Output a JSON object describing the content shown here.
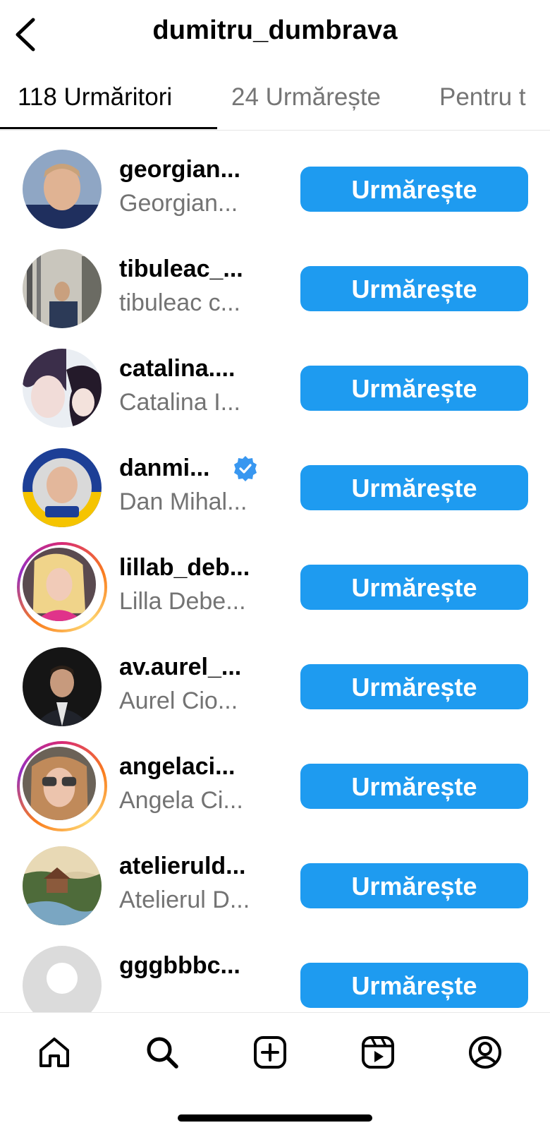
{
  "header": {
    "title": "dumitru_dumbrava"
  },
  "tabs": [
    {
      "label": "118 Urmăritori",
      "active": true
    },
    {
      "label": "24 Urmărește",
      "active": false
    },
    {
      "label": "Pentru t",
      "active": false
    }
  ],
  "follow_label": "Urmărește",
  "followers": [
    {
      "username": "georgian...",
      "full_name": "Georgian...",
      "verified": false,
      "story_ring": false
    },
    {
      "username": "tibuleac_...",
      "full_name": "tibuleac c...",
      "verified": false,
      "story_ring": false
    },
    {
      "username": "catalina....",
      "full_name": "Catalina I...",
      "verified": false,
      "story_ring": false
    },
    {
      "username": "danmi...",
      "full_name": "Dan Mihal...",
      "verified": true,
      "story_ring": false
    },
    {
      "username": "lillab_deb...",
      "full_name": "Lilla Debe...",
      "verified": false,
      "story_ring": true
    },
    {
      "username": "av.aurel_...",
      "full_name": "Aurel Cio...",
      "verified": false,
      "story_ring": false
    },
    {
      "username": "angelaci...",
      "full_name": "Angela Ci...",
      "verified": false,
      "story_ring": true
    },
    {
      "username": "atelieruld...",
      "full_name": "Atelierul D...",
      "verified": false,
      "story_ring": false
    },
    {
      "username": "gggbbbc...",
      "full_name": "",
      "verified": false,
      "story_ring": false
    }
  ],
  "nav": [
    {
      "icon": "home-icon"
    },
    {
      "icon": "search-icon"
    },
    {
      "icon": "create-icon"
    },
    {
      "icon": "reels-icon"
    },
    {
      "icon": "profile-icon"
    }
  ],
  "colors": {
    "button": "#1e9bf0",
    "secondary_text": "#737373",
    "verified_badge": "#3897f0"
  }
}
